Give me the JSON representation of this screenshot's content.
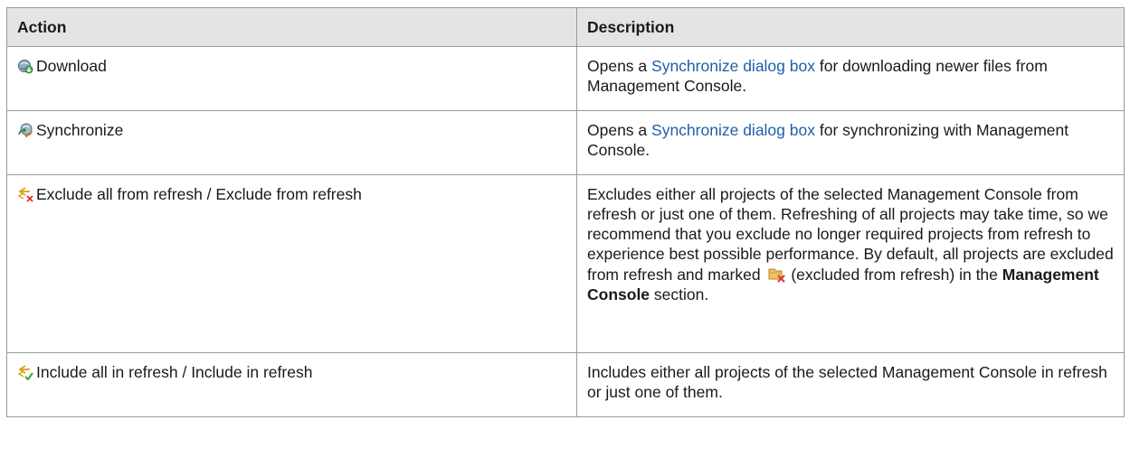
{
  "header": {
    "action": "Action",
    "description": "Description"
  },
  "rows": [
    {
      "icon": "download-icon",
      "action": "Download",
      "desc_before": "Opens a ",
      "desc_link": "Synchronize dialog box",
      "desc_after": " for downloading newer files from Management Console."
    },
    {
      "icon": "synchronize-icon",
      "action": "Synchronize",
      "desc_before": "Opens a ",
      "desc_link": "Synchronize dialog box",
      "desc_after": " for synchronizing with Management Console."
    },
    {
      "icon": "exclude-from-refresh-icon",
      "action": "Exclude all from refresh / Exclude from refresh",
      "desc_part1": "Excludes either all projects of the selected Management Console from refresh or just one of them. Refreshing of all projects may take time, so we recommend that you exclude no longer required projects from refresh to experience best possible performance. By default, all projects are excluded from refresh and marked ",
      "desc_inline_icon": "excluded-project-icon",
      "desc_part2": " (excluded from refresh) in the ",
      "desc_bold": "Management Console",
      "desc_part3": " section."
    },
    {
      "icon": "include-in-refresh-icon",
      "action": "Include all in refresh / Include in refresh",
      "desc": "Includes either all projects of the selected Management Console in refresh or just one of them."
    }
  ],
  "colors": {
    "header_bg": "#e4e4e4",
    "border": "#9a9a9a",
    "link": "#1f5fa8"
  }
}
